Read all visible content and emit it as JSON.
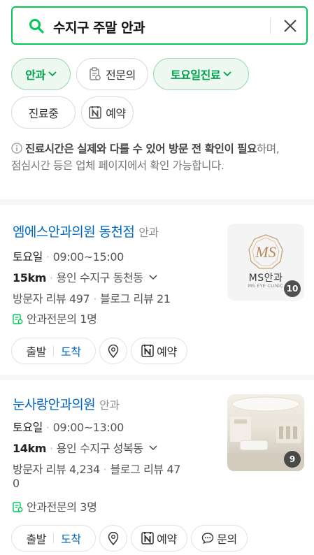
{
  "search": {
    "query": "수지구 주말 안과"
  },
  "filters": [
    {
      "label": "안과",
      "active": true,
      "icon": "chevron-down-icon"
    },
    {
      "label": "전문의",
      "active": false,
      "icon": "specialist-doc-icon"
    },
    {
      "label": "토요일진료",
      "active": true,
      "icon": "chevron-down-icon"
    },
    {
      "label": "진료중",
      "active": false
    },
    {
      "label": "예약",
      "active": false,
      "icon": "naver-n-icon"
    }
  ],
  "notice": {
    "bold": "진료시간은 실제와 다를 수 있어 방문 전 확인이 필요",
    "rest": "하며, 점심시간 등은 업체 페이지에서 확인 가능합니다."
  },
  "results": [
    {
      "name": "엠에스안과의원 동천점",
      "category": "안과",
      "day": "토요일",
      "hours": "09:00~15:00",
      "distance": "15km",
      "address": "용인 수지구 동천동",
      "visitor_reviews": "방문자 리뷰 497",
      "blog_reviews": "블로그 리뷰 21",
      "specialists": "안과전문의 1명",
      "photo_count": "10",
      "logo_text": "MS안과",
      "logo_sub": "MS EYE CLINIC",
      "actions": {
        "depart": "출발",
        "arrive": "도착",
        "reserve": "예약"
      }
    },
    {
      "name": "눈사랑안과의원",
      "category": "안과",
      "day": "토요일",
      "hours": "09:00~13:00",
      "distance": "14km",
      "address": "용인 수지구 성복동",
      "visitor_reviews": "방문자 리뷰 4,234",
      "blog_reviews_line1": "블로그 리뷰 47",
      "blog_reviews_line2": "0",
      "specialists": "안과전문의 3명",
      "photo_count": "9",
      "actions": {
        "depart": "출발",
        "arrive": "도착",
        "reserve": "예약",
        "inquiry": "문의"
      }
    }
  ],
  "colors": {
    "accent": "#03c75a",
    "chip_active_text": "#00a14b",
    "link_blue": "#0068c3"
  }
}
